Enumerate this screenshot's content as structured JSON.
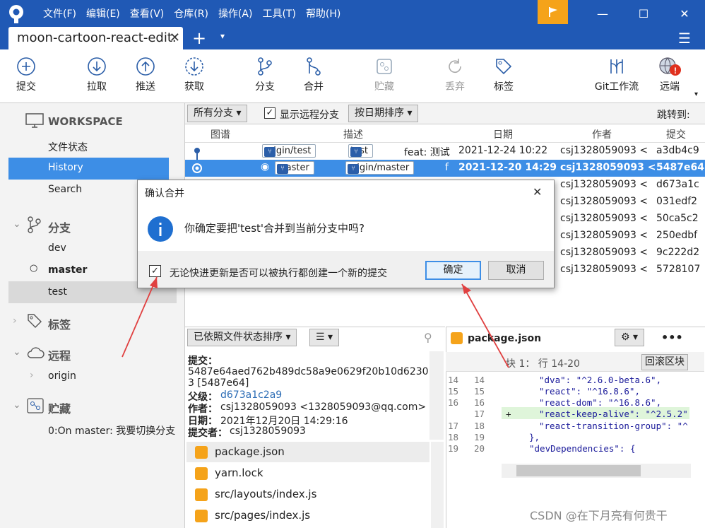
{
  "menu": [
    "文件(F)",
    "编辑(E)",
    "查看(V)",
    "仓库(R)",
    "操作(A)",
    "工具(T)",
    "帮助(H)"
  ],
  "window_controls": {
    "minimize": "—",
    "maximize": "☐",
    "close": "✕"
  },
  "tab": {
    "label": "moon-cartoon-react-edit.",
    "close": "✕",
    "new": "+",
    "dropdown": "▾"
  },
  "toolbar": [
    {
      "label": "提交",
      "icon": "plus-circle-icon",
      "enabled": true
    },
    {
      "label": "拉取",
      "icon": "arrow-down-circle-icon",
      "enabled": true
    },
    {
      "label": "推送",
      "icon": "arrow-up-circle-icon",
      "enabled": true
    },
    {
      "label": "获取",
      "icon": "fetch-icon",
      "enabled": true
    },
    {
      "label": "分支",
      "icon": "branch-icon",
      "enabled": true
    },
    {
      "label": "合并",
      "icon": "merge-icon",
      "enabled": true
    },
    {
      "label": "贮藏",
      "icon": "stash-icon",
      "enabled": false
    },
    {
      "label": "丢弃",
      "icon": "discard-icon",
      "enabled": false
    },
    {
      "label": "标签",
      "icon": "tag-icon",
      "enabled": true
    },
    {
      "label": "Git工作流",
      "icon": "git-flow-icon",
      "enabled": true
    },
    {
      "label": "远端",
      "icon": "remote-globe-icon",
      "enabled": true
    }
  ],
  "sidebar": {
    "workspace": "WORKSPACE",
    "workspace_items": [
      "文件状态",
      "History",
      "Search"
    ],
    "branches_head": "分支",
    "branches": [
      "dev",
      "master",
      "test"
    ],
    "tags_head": "标签",
    "remotes_head": "远程",
    "remotes": [
      "origin"
    ],
    "stash_head": "贮藏",
    "stashes": [
      "0:On master: 我要切换分支"
    ]
  },
  "filterbar": {
    "branches": "所有分支 ▾",
    "show_remote": "显示远程分支",
    "sort": "按日期排序 ▾",
    "jump": "跳转到:"
  },
  "columns": [
    "图谱",
    "描述",
    "日期",
    "作者",
    "提交"
  ],
  "commits": [
    {
      "tags": [
        "origin/test",
        "test"
      ],
      "desc": "feat: 测试",
      "date": "2021-12-24 10:22",
      "author": "csj1328059093 <",
      "hash": "a3db4c9"
    },
    {
      "tags": [
        "master",
        "origin/master"
      ],
      "desc": "f",
      "date": "2021-12-20 14:29",
      "author": "csj1328059093 <",
      "hash": "5487e64"
    },
    {
      "tags": [],
      "desc": "",
      "date": "",
      "author": "csj1328059093 <",
      "hash": "d673a1c"
    },
    {
      "tags": [],
      "desc": "",
      "date": "",
      "author": "csj1328059093 <",
      "hash": "031edf2"
    },
    {
      "tags": [],
      "desc": "",
      "date": "",
      "author": "csj1328059093 <",
      "hash": "50ca5c2"
    },
    {
      "tags": [],
      "desc": "",
      "date": "",
      "author": "csj1328059093 <",
      "hash": "250edbf"
    },
    {
      "tags": [],
      "desc": "",
      "date": "",
      "author": "csj1328059093 <",
      "hash": "9c222d2"
    },
    {
      "tags": [],
      "desc": "",
      "date": "",
      "author": "csj1328059093 <",
      "hash": "5728107"
    }
  ],
  "lower": {
    "sort": "已依照文件状态排序 ▾",
    "view": "☰ ▾",
    "commit_label": "提交：",
    "commit_hash_1": "5487e64aed762b489dc58a9e0629f20b10d6230",
    "commit_hash_2": "3 [5487e64]",
    "parent_label": "父级：",
    "parent": "d673a1c2a9",
    "author_label": "作者：",
    "author": "csj1328059093 <1328059093@qq.com>",
    "date_label": "日期：",
    "date": "2021年12月20日 14:29:16",
    "committer_label": "提交者：",
    "committer": "csj1328059093",
    "files": [
      "package.json",
      "yarn.lock",
      "src/layouts/index.js",
      "src/pages/index.js"
    ]
  },
  "diff": {
    "file": "package.json",
    "hunk": "块 1： 行 14-20",
    "revert": "回滚区块",
    "lines": [
      {
        "a": "14",
        "b": "14",
        "mark": "",
        "text": "\"dva\": \"^2.6.0-beta.6\","
      },
      {
        "a": "15",
        "b": "15",
        "mark": "",
        "text": "\"react\": \"^16.8.6\","
      },
      {
        "a": "16",
        "b": "16",
        "mark": "",
        "text": "\"react-dom\": \"^16.8.6\","
      },
      {
        "a": "",
        "b": "17",
        "mark": "+",
        "text": "\"react-keep-alive\": \"^2.5.2\""
      },
      {
        "a": "17",
        "b": "18",
        "mark": "",
        "text": "\"react-transition-group\": \"^"
      },
      {
        "a": "18",
        "b": "19",
        "mark": "",
        "text": "},"
      },
      {
        "a": "19",
        "b": "20",
        "mark": "",
        "text": "\"devDependencies\": {"
      }
    ]
  },
  "dialog": {
    "title": "确认合并",
    "close": "✕",
    "message": "你确定要把'test'合并到当前分支中吗?",
    "checkbox": "无论快进更新是否可以被执行都创建一个新的提交",
    "ok": "确定",
    "cancel": "取消"
  },
  "watermark": "CSDN @在下月亮有何贵干",
  "colors": {
    "titlebar": "#2059b5",
    "selection": "#3d8ee6",
    "flag": "#f5a31a",
    "arrow": "#e04040"
  }
}
